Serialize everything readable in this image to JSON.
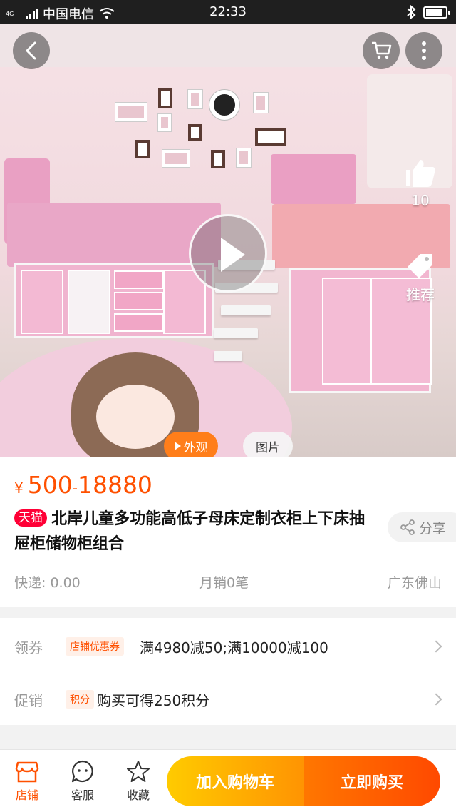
{
  "status_bar": {
    "network": "4G",
    "carrier": "中国电信",
    "time": "22:33",
    "battery_level": 0.85
  },
  "hero": {
    "like_count": "10",
    "recommend_label": "推荐",
    "tabs": [
      {
        "label": "外观",
        "active": true
      },
      {
        "label": "图片",
        "active": false
      }
    ]
  },
  "product": {
    "currency": "¥",
    "price_low": "500",
    "price_sep": "-",
    "price_high": "18880",
    "badge": "天猫",
    "title": "北岸儿童多功能高低子母床定制衣柜上下床抽屉柜储物柜组合",
    "share_label": "分享",
    "shipping": "快递: 0.00",
    "monthly_sales": "月销0笔",
    "location": "广东佛山"
  },
  "rows": {
    "coupon": {
      "label": "领券",
      "tag": "店铺优惠券",
      "text": "满4980减50;满10000减100"
    },
    "promo": {
      "label": "促销",
      "tag": "积分",
      "text": "购买可得250积分"
    }
  },
  "bottom_bar": {
    "shop_label": "店铺",
    "service_label": "客服",
    "favorite_label": "收藏",
    "add_cart_label": "加入购物车",
    "buy_now_label": "立即购买"
  },
  "colors": {
    "accent": "#ff5000",
    "tmall_red": "#ff0036",
    "cart_yellow": "#ffcb00",
    "buy_orange": "#ff4900"
  }
}
